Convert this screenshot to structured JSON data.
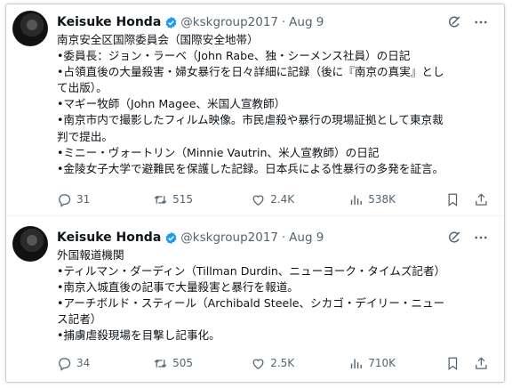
{
  "tweets": [
    {
      "name": "Keisuke Honda",
      "handle": "@kskgroup2017",
      "time": "Aug 9",
      "lines": [
        "南京安全区国際委員会（国際安全地帯）",
        "•委員長：ジョン・ラーベ（John Rabe、独・シーメンス社員）の日記",
        "•占領直後の大量殺害・婦女暴行を日々詳細に記録（後に『南京の真実』とし",
        "て出版）。",
        "•マギー牧師（John Magee、米国人宣教師）",
        "•南京市内で撮影したフィルム映像。市民虐殺や暴行の現場証拠として東京裁",
        "判で提出。",
        "•ミニー・ヴォートリン（Minnie Vautrin、米人宣教師）の日記",
        "•金陵女子大学で避難民を保護した記録。日本兵による性暴行の多発を証言。"
      ],
      "replies": "31",
      "retweets": "515",
      "likes": "2.4K",
      "views": "538K"
    },
    {
      "name": "Keisuke Honda",
      "handle": "@kskgroup2017",
      "time": "Aug 9",
      "lines": [
        "外国報道機関",
        "•ティルマン・ダーディン（Tillman Durdin、ニューヨーク・タイムズ記者）",
        "•南京入城直後の記事で大量殺害と暴行を報道。",
        "•アーチボルド・スティール（Archibald Steele、シカゴ・デイリー・ニュー",
        "ス記者）",
        "•捕虜虐殺現場を目撃し記事化。"
      ],
      "replies": "34",
      "retweets": "505",
      "likes": "2.5K",
      "views": "710K"
    }
  ],
  "separator": "·",
  "colors": {
    "verified": "#1d9bf0",
    "muted": "#536471",
    "text": "#0f1419"
  }
}
